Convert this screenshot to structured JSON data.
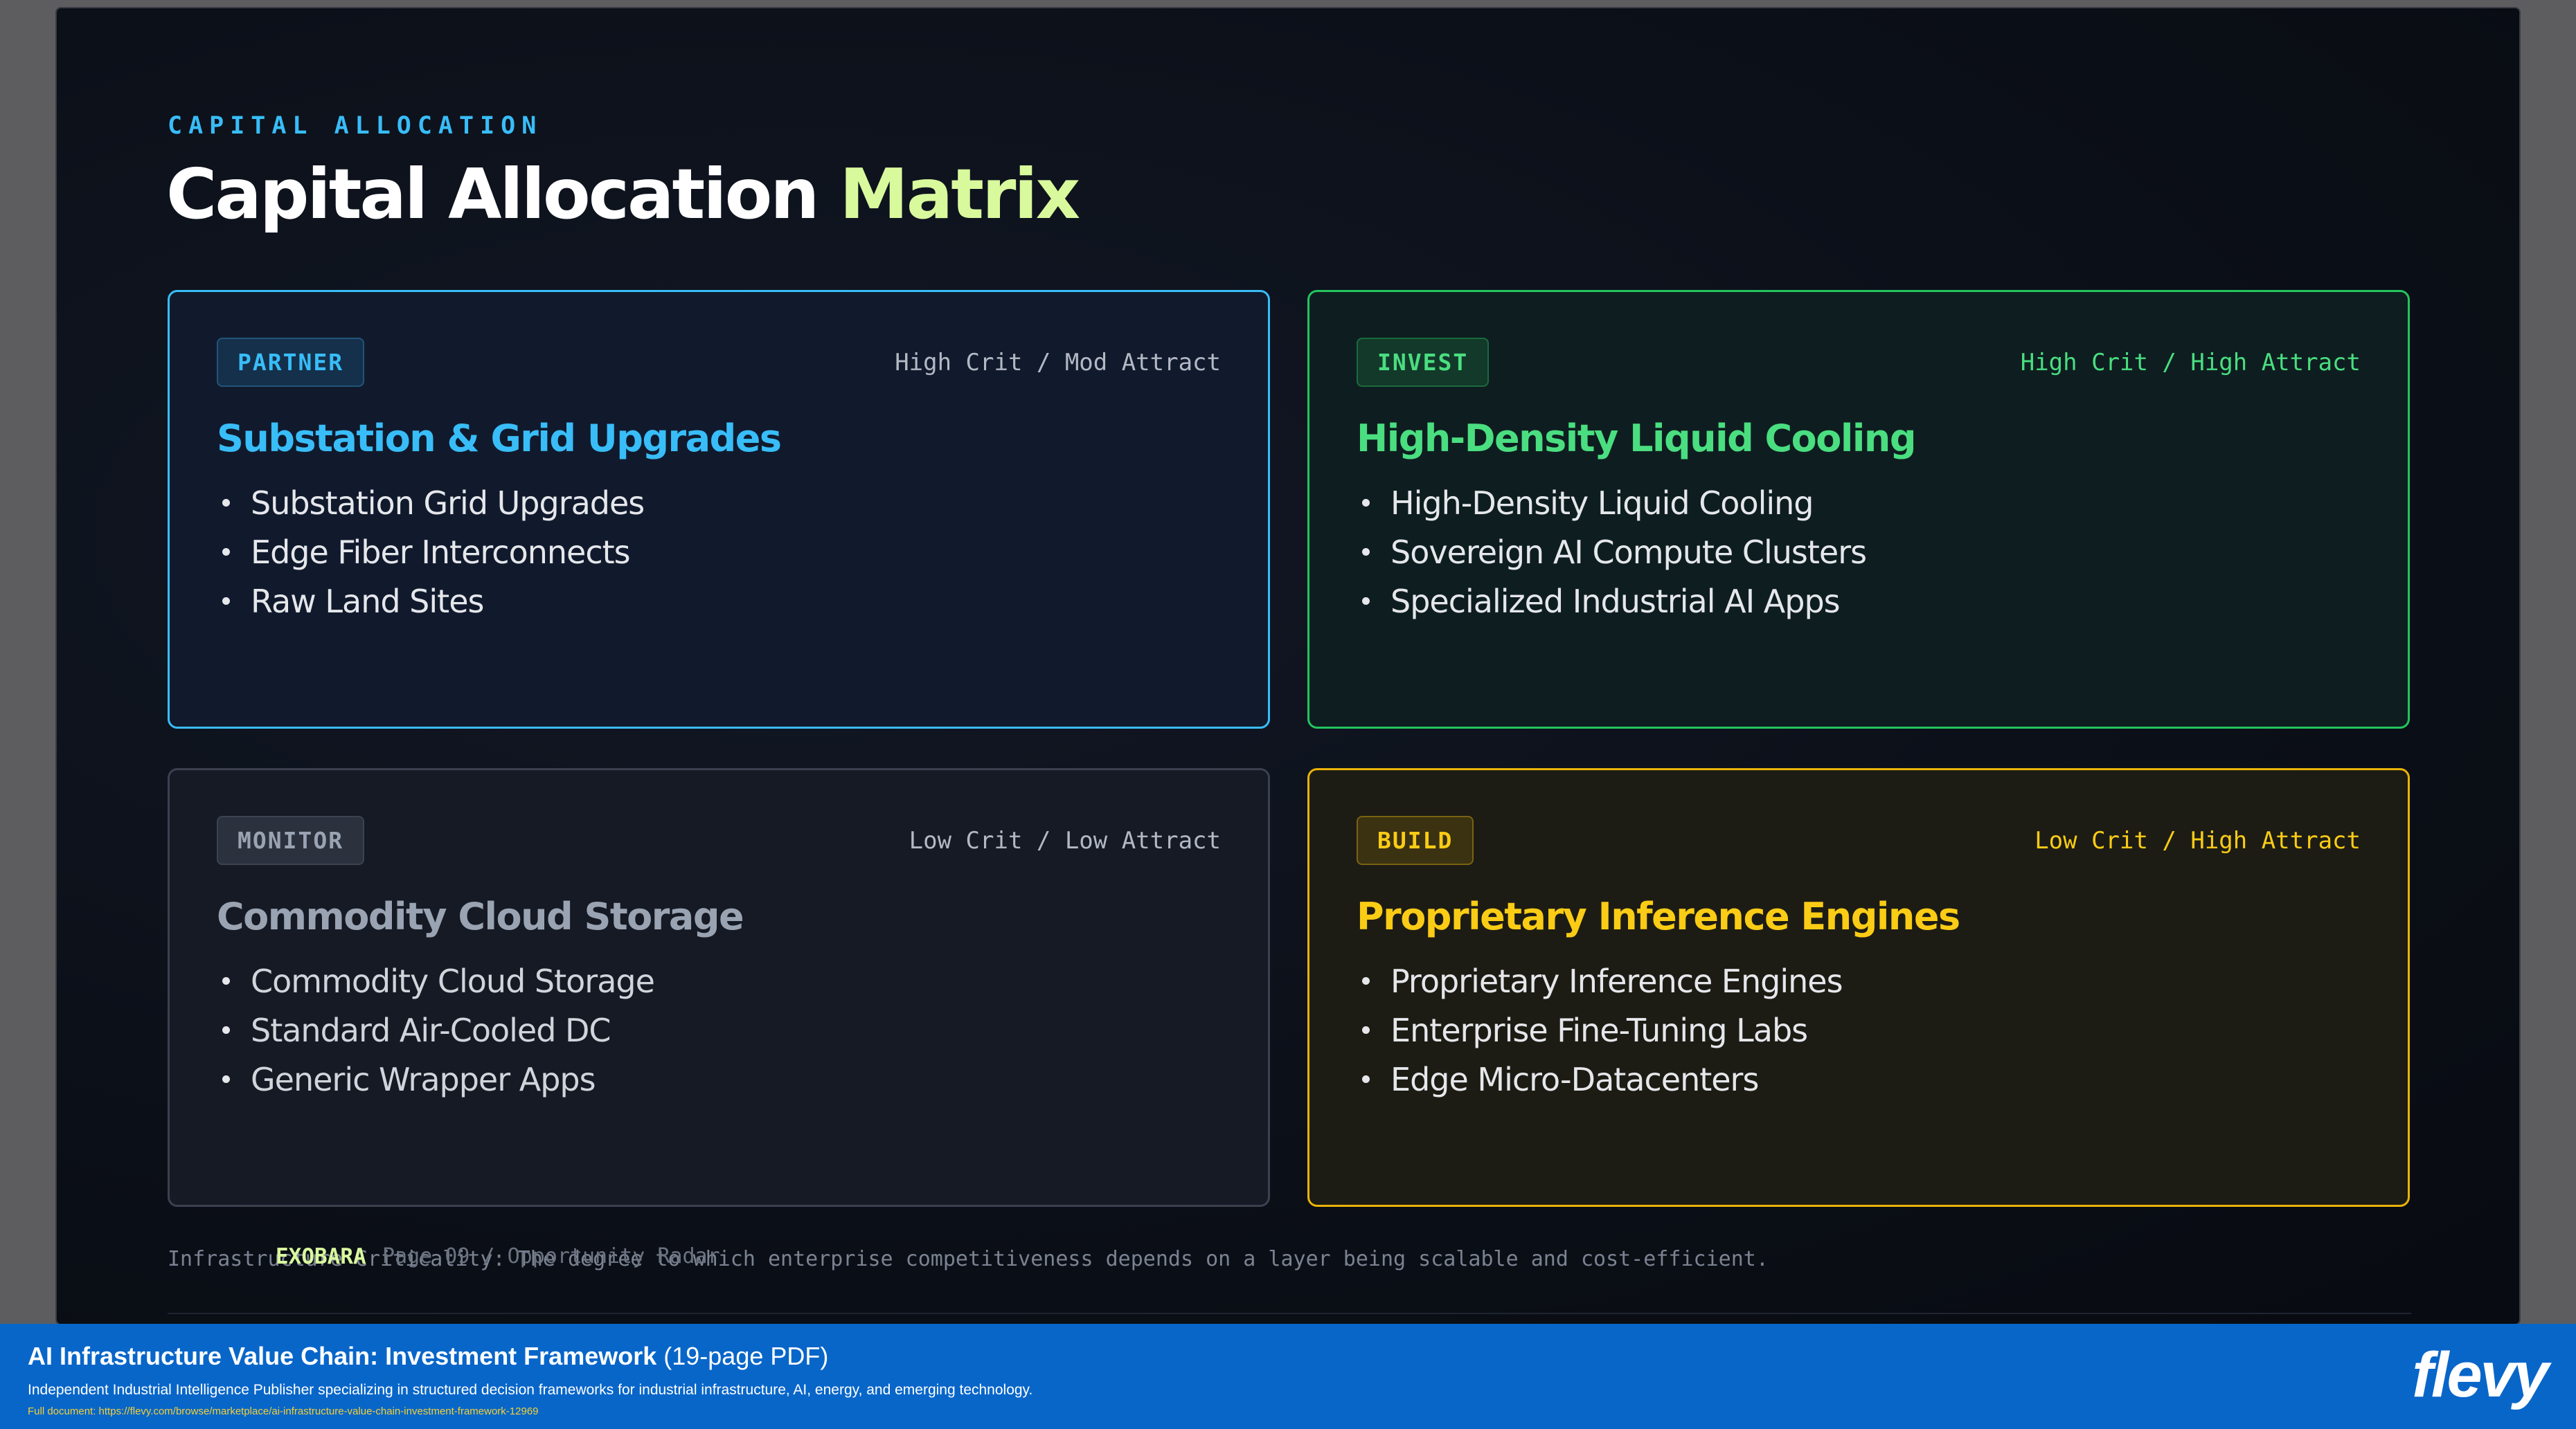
{
  "slide": {
    "eyebrow": "CAPITAL ALLOCATION",
    "title_main": "Capital Allocation ",
    "title_accent": "Matrix",
    "quadrants": [
      {
        "badge": "PARTNER",
        "meta": "High Crit / Mod Attract",
        "title": "Substation & Grid Upgrades",
        "items": [
          "Substation Grid Upgrades",
          "Edge Fiber Interconnects",
          "Raw Land Sites"
        ]
      },
      {
        "badge": "INVEST",
        "meta": "High Crit / High Attract",
        "title": "High-Density Liquid Cooling",
        "items": [
          "High-Density Liquid Cooling",
          "Sovereign AI Compute Clusters",
          "Specialized Industrial AI Apps"
        ]
      },
      {
        "badge": "MONITOR",
        "meta": "Low Crit / Low Attract",
        "title": "Commodity Cloud Storage",
        "items": [
          "Commodity Cloud Storage",
          "Standard Air-Cooled DC",
          "Generic Wrapper Apps"
        ]
      },
      {
        "badge": "BUILD",
        "meta": "Low Crit / High Attract",
        "title": "Proprietary Inference Engines",
        "items": [
          "Proprietary Inference Engines",
          "Enterprise Fine-Tuning Labs",
          "Edge Micro-Datacenters"
        ]
      }
    ],
    "footnote": "Infrastructure Criticality: The degree to which enterprise competitiveness depends on a layer being scalable and cost-efficient.",
    "brand": "EXOBARA",
    "page_overlay": "Page 09 / Opportunity Radar"
  },
  "banner": {
    "title": "AI Infrastructure Value Chain: Investment Framework",
    "pages": " (19-page PDF)",
    "description": "Independent Industrial Intelligence Publisher specializing in structured decision frameworks for industrial infrastructure, AI, energy, and emerging technology.",
    "url": "Full document: https://flevy.com/browse/marketplace/ai-infrastructure-value-chain-investment-framework-12969",
    "logo": "flevy"
  }
}
